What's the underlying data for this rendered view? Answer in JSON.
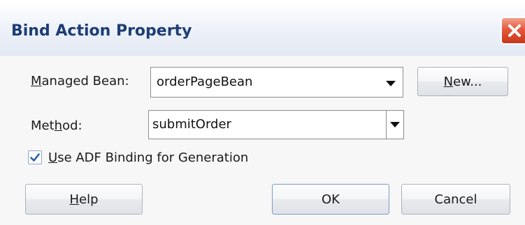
{
  "dialog": {
    "title": "Bind Action Property",
    "close_icon": "close-x-icon"
  },
  "managed_bean": {
    "label_first": "M",
    "label_rest": "anaged Bean:",
    "value": "orderPageBean"
  },
  "new_button": {
    "label_first": "N",
    "label_rest": "ew..."
  },
  "method": {
    "label_pre": "Met",
    "label_u": "h",
    "label_post": "od:",
    "value": "submitOrder"
  },
  "adf_binding": {
    "checked": true,
    "label_first": "U",
    "label_rest": "se ADF Binding for Generation"
  },
  "buttons": {
    "help_first": "H",
    "help_rest": "elp",
    "ok": "OK",
    "cancel": "Cancel"
  },
  "colors": {
    "title_text": "#1d3d75",
    "close_button": "#e4593a",
    "checkmark": "#2a5fa8"
  }
}
